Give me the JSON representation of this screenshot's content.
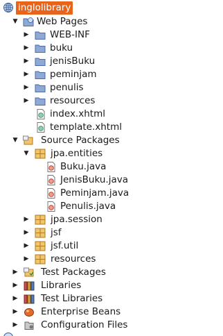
{
  "project": {
    "name": "inglolibrary",
    "nodes": {
      "web_pages": {
        "label": "Web Pages",
        "children": [
          "WEB-INF",
          "buku",
          "jenisBuku",
          "peminjam",
          "penulis",
          "resources",
          "index.xhtml",
          "template.xhtml"
        ]
      },
      "source_packages": {
        "label": "Source Packages",
        "jpa_entities": {
          "label": "jpa.entities",
          "children": [
            "Buku.java",
            "JenisBuku.java",
            "Peminjam.java",
            "Penulis.java"
          ]
        },
        "packages": [
          "jpa.session",
          "jsf",
          "jsf.util",
          "resources"
        ]
      },
      "others": [
        "Test Packages",
        "Libraries",
        "Test Libraries",
        "Enterprise Beans",
        "Configuration Files"
      ]
    }
  },
  "colors": {
    "selection": "#e8641b",
    "folder": "#5a7bb5",
    "package": "#e2a23a",
    "java_file": "#cc3b2b"
  }
}
